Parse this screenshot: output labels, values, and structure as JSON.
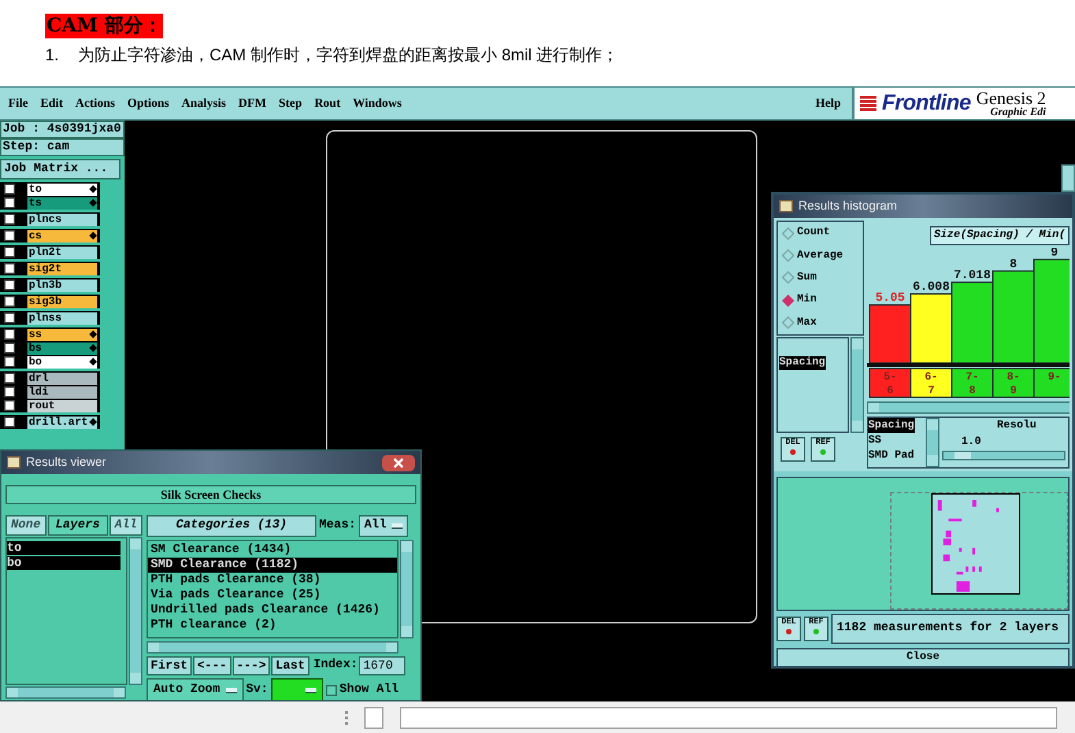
{
  "document": {
    "heading": "CAM 部分：",
    "item_number": "1.",
    "item_text": "为防止字符渗油，CAM 制作时，字符到焊盘的距离按最小 8mil 进行制作；"
  },
  "menu": [
    "File",
    "Edit",
    "Actions",
    "Options",
    "Analysis",
    "DFM",
    "Step",
    "Rout",
    "Windows"
  ],
  "help": "Help",
  "brand": {
    "logo": "Frontline",
    "product": "Genesis 2",
    "subtitle": "Graphic Edi"
  },
  "job": {
    "job": "Job : 4s0391jxa0",
    "step": "Step: cam",
    "matrix_button": "Job Matrix ..."
  },
  "layer_groups": [
    [
      {
        "name": "to",
        "color": "#ffffff",
        "marker": true,
        "checked": false
      },
      {
        "name": "ts",
        "color": "#169c7c",
        "marker": true,
        "checked": false
      }
    ],
    [
      {
        "name": "plncs",
        "color": "#9ddcdc",
        "marker": false,
        "checked": false
      }
    ],
    [
      {
        "name": "cs",
        "color": "#f6b93c",
        "marker": true,
        "checked": false
      }
    ],
    [
      {
        "name": "pln2t",
        "color": "#9ddcdc",
        "marker": false,
        "checked": false
      }
    ],
    [
      {
        "name": "sig2t",
        "color": "#f6b93c",
        "marker": false,
        "checked": false
      }
    ],
    [
      {
        "name": "pln3b",
        "color": "#9ddcdc",
        "marker": false,
        "checked": false
      }
    ],
    [
      {
        "name": "sig3b",
        "color": "#f6b93c",
        "marker": false,
        "checked": false
      }
    ],
    [
      {
        "name": "plnss",
        "color": "#9ddcdc",
        "marker": false,
        "checked": false
      }
    ],
    [
      {
        "name": "ss",
        "color": "#f6b93c",
        "marker": true,
        "checked": false
      },
      {
        "name": "bs",
        "color": "#169c7c",
        "marker": true,
        "checked": false
      },
      {
        "name": "bo",
        "color": "#ffffff",
        "marker": true,
        "checked": false
      }
    ],
    [
      {
        "name": "drl",
        "color": "#a9b9bd",
        "marker": false,
        "checked": false
      },
      {
        "name": "ldi",
        "color": "#a9b9bd",
        "marker": false,
        "checked": false
      },
      {
        "name": "rout",
        "color": "#c9d3d5",
        "marker": false,
        "checked": false
      }
    ],
    [
      {
        "name": "drill.art",
        "color": "#9ddcdc",
        "marker": true,
        "checked": false
      }
    ]
  ],
  "results_viewer": {
    "title": "Results viewer",
    "header": "Silk Screen Checks",
    "layer_buttons": [
      {
        "label": "None",
        "selected": false
      },
      {
        "label": "Layers",
        "selected": true
      },
      {
        "label": "All",
        "selected": false
      }
    ],
    "layers": [
      {
        "name": "to",
        "selected": true
      },
      {
        "name": "bo",
        "selected": true
      }
    ],
    "categories_button": "Categories (13)",
    "meas_label": "Meas:",
    "meas_value": "All",
    "categories": [
      {
        "label": "SM Clearance (1434)",
        "selected": false
      },
      {
        "label": "SMD Clearance (1182)",
        "selected": true
      },
      {
        "label": "PTH pads Clearance (38)",
        "selected": false
      },
      {
        "label": "Via pads Clearance (25)",
        "selected": false
      },
      {
        "label": "Undrilled pads Clearance (1426)",
        "selected": false
      },
      {
        "label": "PTH clearance (2)",
        "selected": false
      }
    ],
    "nav": [
      "First",
      "<---",
      "--->",
      "Last"
    ],
    "index_label": "Index:",
    "index_value": "1670",
    "zoom": "Auto Zoom",
    "sv_label": "Sv:",
    "sv": {
      "color": "#22dd22"
    },
    "show_all": {
      "label": "Show All",
      "checked": false
    }
  },
  "histogram": {
    "title": "Results histogram",
    "modes": [
      {
        "label": "Count",
        "selected": false
      },
      {
        "label": "Average",
        "selected": false
      },
      {
        "label": "Sum",
        "selected": false
      },
      {
        "label": "Min",
        "selected": true
      },
      {
        "label": "Max",
        "selected": false
      }
    ],
    "measures": [
      {
        "label": "Spacing",
        "selected": true
      }
    ],
    "del_top": "DEL",
    "ref_top": "REF",
    "chart_data": {
      "type": "bar",
      "title": "Size(Spacing) / Min(",
      "categories": [
        "5-6",
        "6-7",
        "7-8",
        "8-9",
        "9-"
      ],
      "values": [
        5.05,
        6.008,
        7.018,
        8,
        9
      ],
      "data_labels": true
    },
    "bins": [
      {
        "color": "#ff2020"
      },
      {
        "color": "#ffff20"
      },
      {
        "color": "#22dd22"
      },
      {
        "color": "#22dd22"
      },
      {
        "color": "#22dd22"
      }
    ],
    "value_labels": [
      "5.05",
      "6.008",
      "7.018",
      "8",
      "9"
    ],
    "types": [
      {
        "label": "Spacing",
        "selected": true
      },
      {
        "label": "SS",
        "selected": false
      },
      {
        "label": "SMD Pad",
        "selected": false
      }
    ],
    "resolution_label": "Resolu",
    "resolution_value": "1.0",
    "resolution_slider": {
      "level": 0.1
    },
    "del_bottom": "DEL",
    "ref_bottom": "REF",
    "status": "1182 measurements for 2 layers",
    "close": "Close"
  }
}
